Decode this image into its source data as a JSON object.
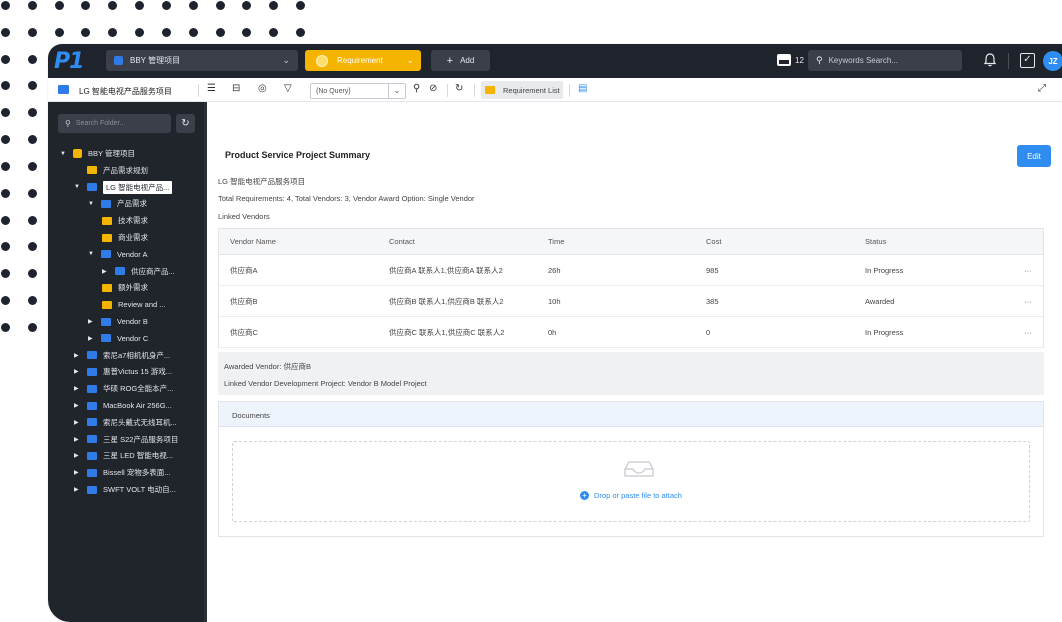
{
  "topbar": {
    "logo": "P1",
    "project_select": "BBY 管理项目",
    "requirement_label": "Requirement",
    "add_label": "Add",
    "calendar_count": "12",
    "search_placeholder": "Keywords Search...",
    "avatar_initials": "JZ"
  },
  "toolbar": {
    "title": "LG 智能电视产品服务项目",
    "query_value": "{No Query}",
    "requirement_list_label": "Requirement List"
  },
  "sidebar": {
    "search_placeholder": "Search Folder...",
    "tree": [
      {
        "label": "BBY 管理项目",
        "arrow": "▼",
        "icon": "cube"
      },
      {
        "label": "产品需求规划",
        "arrow": "",
        "icon": "yellow"
      },
      {
        "label": "LG 智能电视产品...",
        "arrow": "▼",
        "icon": "blue"
      },
      {
        "label": "产品需求",
        "arrow": "▼",
        "icon": "blue"
      },
      {
        "label": "技术需求",
        "arrow": "",
        "icon": "yellow"
      },
      {
        "label": "商业需求",
        "arrow": "",
        "icon": "yellow"
      },
      {
        "label": "Vendor A",
        "arrow": "▼",
        "icon": "blue"
      },
      {
        "label": "供应商产品...",
        "arrow": "▶",
        "icon": "blue"
      },
      {
        "label": "额外需求",
        "arrow": "",
        "icon": "yellow"
      },
      {
        "label": "Review and ...",
        "arrow": "",
        "icon": "yellow"
      },
      {
        "label": "Vendor B",
        "arrow": "▶",
        "icon": "blue"
      },
      {
        "label": "Vendor C",
        "arrow": "▶",
        "icon": "blue"
      },
      {
        "label": "索尼a7相机机身产...",
        "arrow": "▶",
        "icon": "blue"
      },
      {
        "label": "惠普Victus 15 游戏...",
        "arrow": "▶",
        "icon": "blue"
      },
      {
        "label": "华硕 ROG全能本产...",
        "arrow": "▶",
        "icon": "blue"
      },
      {
        "label": "MacBook Air 256G...",
        "arrow": "▶",
        "icon": "blue"
      },
      {
        "label": "索尼头戴式无线耳机...",
        "arrow": "▶",
        "icon": "blue"
      },
      {
        "label": "三星 S22产品服务项目",
        "arrow": "▶",
        "icon": "blue"
      },
      {
        "label": "三星 LED 智能电视...",
        "arrow": "▶",
        "icon": "blue"
      },
      {
        "label": "Bissell 宠物多表面...",
        "arrow": "▶",
        "icon": "blue"
      },
      {
        "label": "SWFT VOLT 电动自...",
        "arrow": "▶",
        "icon": "blue"
      }
    ]
  },
  "main": {
    "title": "Product Service Project Summary",
    "edit_label": "Edit",
    "project_name": "LG 智能电视产品服务项目",
    "totals": "Total Requirements: 4, Total Vendors: 3, Vendor Award Option: Single Vendor",
    "linked_vendors_label": "Linked Vendors",
    "table": {
      "headers": [
        "Vendor Name",
        "Contact",
        "Time",
        "Cost",
        "Status"
      ],
      "rows": [
        [
          "供应商A",
          "供应商A 联系人1,供应商A 联系人2",
          "26h",
          "985",
          "In Progress",
          "···"
        ],
        [
          "供应商B",
          "供应商B 联系人1,供应商B 联系人2",
          "10h",
          "385",
          "Awarded",
          "···"
        ],
        [
          "供应商C",
          "供应商C 联系人1,供应商C 联系人2",
          "0h",
          "0",
          "In Progress",
          "···"
        ]
      ]
    },
    "awarded_vendor": "Awarded Vendor: 供应商B",
    "linked_dev_project": "Linked Vendor Development Project: Vendor B Model Project",
    "documents_label": "Documents",
    "attach_label": "Drop or paste file to attach"
  },
  "colors": {
    "accent": "#2f8cf0",
    "requirement": "#f5b400",
    "sidebar_bg": "#20242b"
  }
}
